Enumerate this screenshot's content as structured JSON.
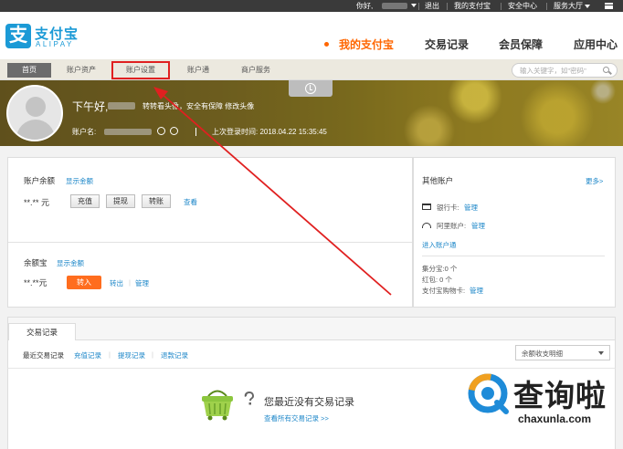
{
  "topbar": {
    "greeting": "你好,",
    "logout": "退出",
    "my_alipay": "我的支付宝",
    "security_center": "安全中心",
    "services": "服务大厅"
  },
  "header": {
    "logo_cn": "支付宝",
    "logo_en": "ALIPAY",
    "logo_glyph": "支",
    "nav": [
      "我的支付宝",
      "交易记录",
      "会员保障",
      "应用中心"
    ],
    "active_color": "#ff6600",
    "brand_color": "#1b9ad6"
  },
  "subnav": {
    "tabs": [
      "首页",
      "账户资产",
      "账户设置",
      "账户通",
      "商户服务"
    ],
    "highlighted_tab": "账户设置",
    "search_placeholder": "输入关键字，如\"密码\""
  },
  "banner": {
    "greeting": "下午好,",
    "sub": "转转看头像，安全有保障 修改头像",
    "account_label": "账户名:",
    "last_login": "上次登录时间: 2018.04.22 15:35:45"
  },
  "balance": {
    "title": "账户余额",
    "show": "显示金额",
    "amount": "**.** 元",
    "buttons": [
      "充值",
      "提现",
      "转账"
    ],
    "view": "查看"
  },
  "yuebao": {
    "title": "余额宝",
    "show": "显示金额",
    "amount": "**.**元",
    "in": "转入",
    "out": "转出",
    "manage": "管理"
  },
  "other": {
    "title": "其他账户",
    "more": "更多>",
    "bank_label": "银行卡:",
    "bank_manage": "管理",
    "ali_label": "阿里账户:",
    "ali_manage": "管理",
    "enter": "进入账户通",
    "points": "集分宝:0 个",
    "redpacket": "红包: 0 个",
    "card_label": "支付宝购物卡:",
    "card_manage": "管理"
  },
  "records": {
    "tab": "交易记录",
    "filters": [
      "最近交易记录",
      "充值记录",
      "提现记录",
      "退款记录"
    ],
    "select": "余额收支明细",
    "empty_title": "您最近没有交易记录",
    "empty_link": "查看所有交易记录 >>"
  },
  "watermark": {
    "text": "查询啦",
    "sub": "chaxunla.com"
  }
}
